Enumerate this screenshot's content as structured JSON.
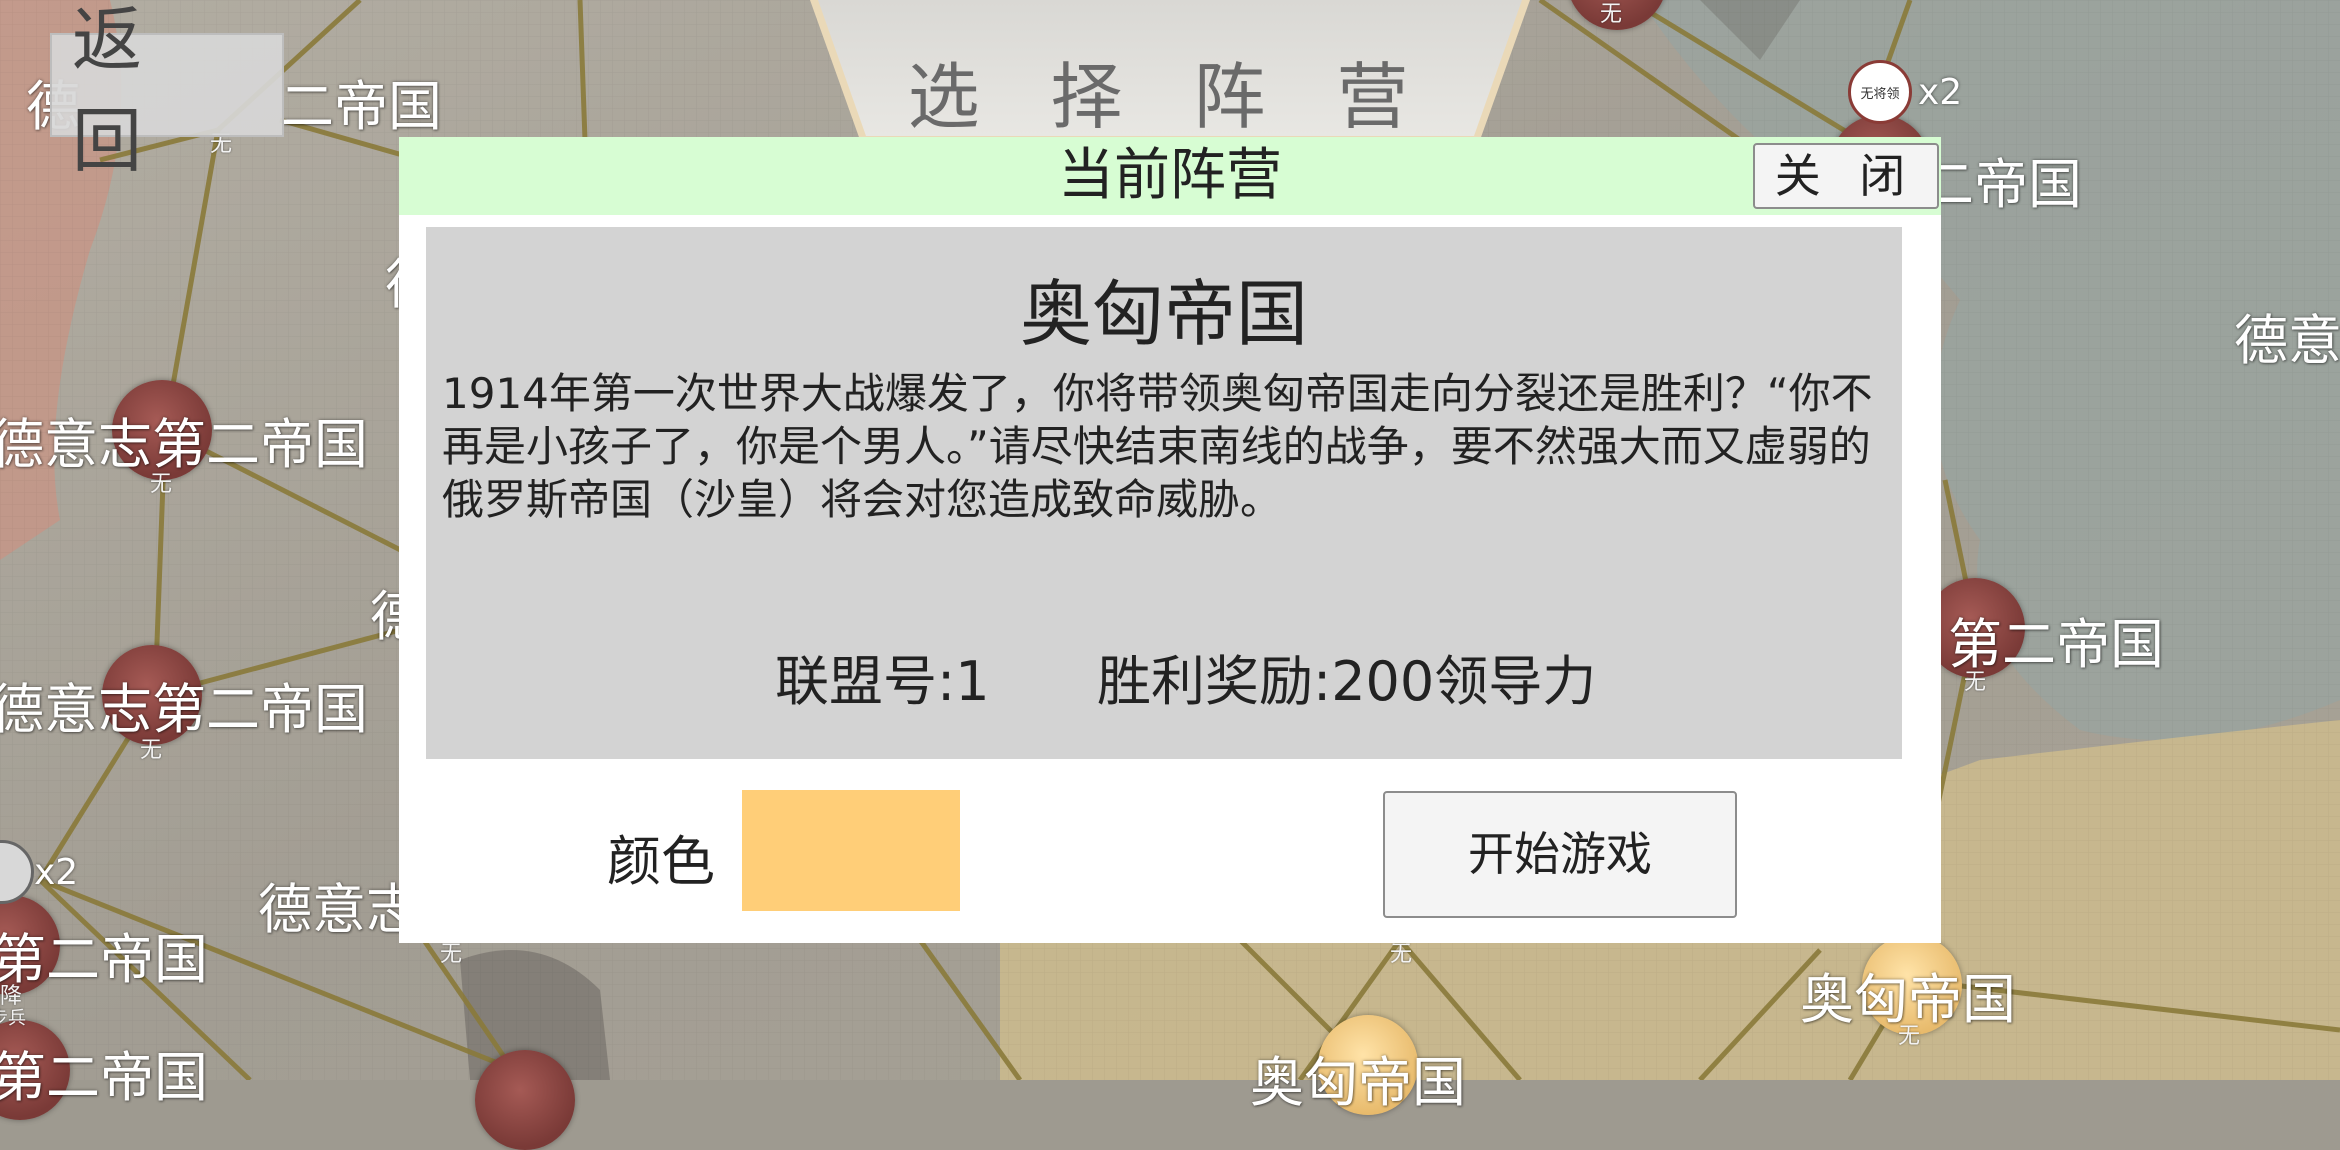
{
  "top_bar": {
    "back_label": "返 回",
    "title": "选 择 阵 营"
  },
  "map": {
    "labels": {
      "de_top": "德",
      "de_top_rest": "二帝国",
      "de1": "德意志第二帝国",
      "de2": "德意志第二帝国",
      "de3": "第二帝国",
      "de4": "第二帝国",
      "de_partial_a": "德",
      "de_partial_b": "德",
      "de_partial_c": "德意志",
      "right_top": "二帝国",
      "right_mid": "第二帝国",
      "right_edge": "德意",
      "ah1": "奥匈帝国",
      "ah2": "奥匈帝国",
      "ah_bottom_partial": "奥匈帝国"
    },
    "sub_none": "无",
    "token_label": "无将领",
    "count_x2": "x2",
    "left_unit_label": "降",
    "left_unit_sub": "步兵"
  },
  "dialog": {
    "header_title": "当前阵营",
    "close_label": "关 闭",
    "faction_name": "奥匈帝国",
    "description": "1914年第一次世界大战爆发了，你将带领奥匈帝国走向分裂还是胜利？“你不再是小孩子了，你是个男人。”请尽快结束南线的战争，要不然强大而又虚弱的俄罗斯帝国（沙皇）将会对您造成致命威胁。",
    "alliance": "联盟号:1",
    "reward": "胜利奖励:200领导力",
    "color_label": "颜色",
    "faction_color": "#ffce78",
    "start_label": "开始游戏"
  },
  "colors": {
    "header_bg": "#d7fdd3",
    "panel_bg": "#d3d3d3",
    "node_red": "#8a3b36",
    "node_gold": "#f0c27a",
    "road": "#8a7a3a"
  }
}
